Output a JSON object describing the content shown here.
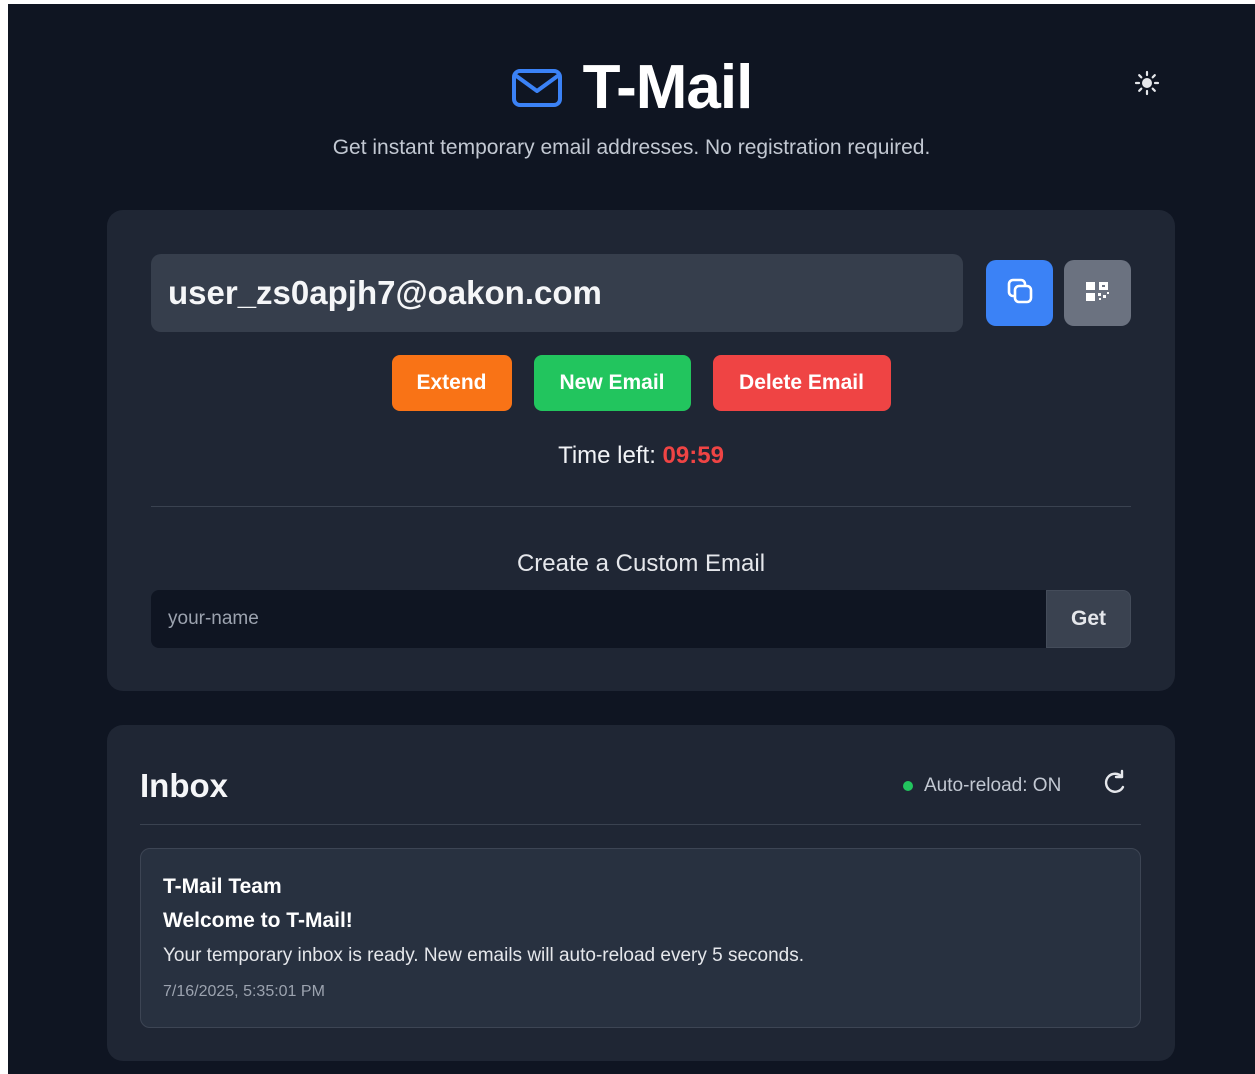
{
  "header": {
    "title": "T-Mail",
    "subtitle": "Get instant temporary email addresses. No registration required.",
    "logo_icon": "mail-icon",
    "theme_icon": "sun-icon"
  },
  "email": {
    "address": "user_zs0apjh7@oakon.com",
    "copy_icon": "copy-icon",
    "qr_icon": "qr-code-icon"
  },
  "actions": {
    "extend_label": "Extend",
    "new_label": "New Email",
    "delete_label": "Delete Email"
  },
  "timer": {
    "label": "Time left: ",
    "value": "09:59"
  },
  "custom": {
    "title": "Create a Custom Email",
    "placeholder": "your-name",
    "value": "",
    "button_label": "Get"
  },
  "inbox": {
    "title": "Inbox",
    "auto_reload_label": "Auto-reload: ON",
    "refresh_icon": "refresh-icon",
    "messages": [
      {
        "from": "T-Mail Team",
        "subject": "Welcome to T-Mail!",
        "body": "Your temporary inbox is ready. New emails will auto-reload every 5 seconds.",
        "time": "7/16/2025, 5:35:01 PM"
      }
    ]
  },
  "colors": {
    "background": "#0f1522",
    "card": "#1f2634",
    "accent_blue": "#3b82f6",
    "extend_orange": "#f97316",
    "new_green": "#22c55e",
    "delete_red": "#ef4444",
    "timer_red": "#ef4444"
  }
}
